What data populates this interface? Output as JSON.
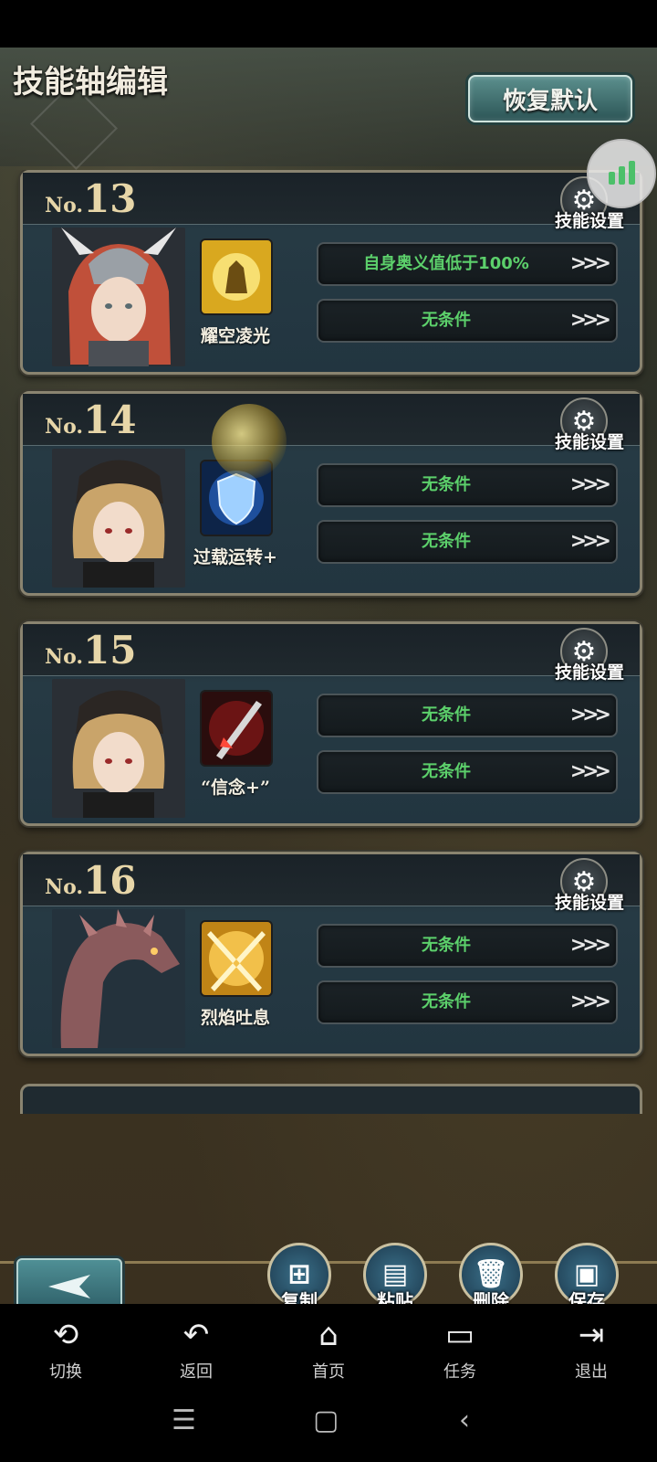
{
  "header": {
    "title": "技能轴编辑",
    "restore_label": "恢复默认"
  },
  "cards": [
    {
      "no_prefix": "No.",
      "number": "13",
      "gear_label": "技能设置",
      "skill_name": "耀空凌光",
      "cond1": "自身奥义值低于100%",
      "cond2": "无条件"
    },
    {
      "no_prefix": "No.",
      "number": "14",
      "gear_label": "技能设置",
      "skill_name": "过载运转+",
      "cond1": "无条件",
      "cond2": "无条件"
    },
    {
      "no_prefix": "No.",
      "number": "15",
      "gear_label": "技能设置",
      "skill_name": "“信念+”",
      "cond1": "无条件",
      "cond2": "无条件"
    },
    {
      "no_prefix": "No.",
      "number": "16",
      "gear_label": "技能设置",
      "skill_name": "烈焰吐息",
      "cond1": "无条件",
      "cond2": "无条件"
    }
  ],
  "toolbar": {
    "copy": "复制",
    "paste": "粘贴",
    "delete": "删除",
    "save": "保存"
  },
  "nav": {
    "switch": "切换",
    "back": "返回",
    "home": "首页",
    "tasks": "任务",
    "exit": "退出"
  },
  "colors": {
    "condition_text": "#5cd06b",
    "number_gold": "#e7d6a8",
    "accent_teal": "#3a6f88"
  }
}
